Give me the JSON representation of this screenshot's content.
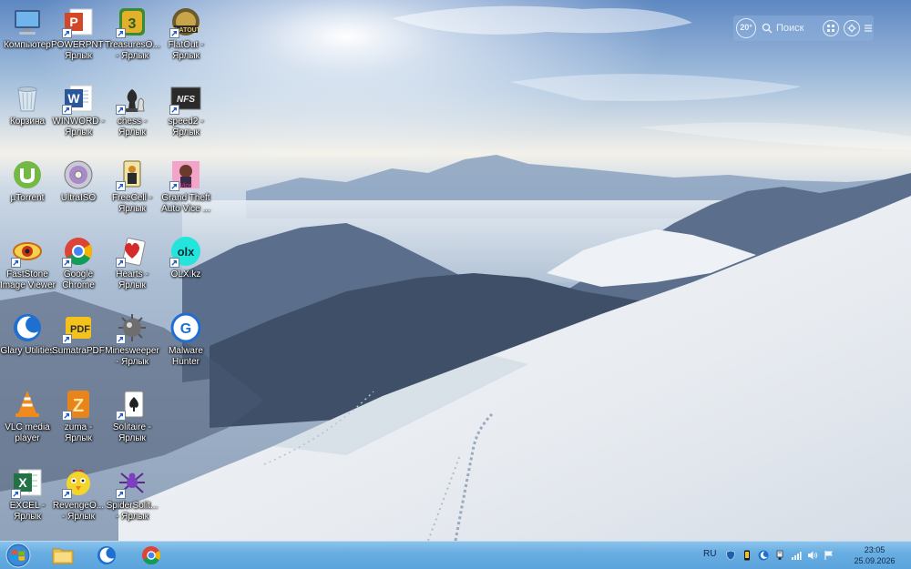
{
  "desktop": {
    "icons": [
      {
        "name": "computer",
        "label1": "Компьютер",
        "label2": ""
      },
      {
        "name": "powerpnt",
        "label1": "POWERPNT -",
        "label2": "Ярлык"
      },
      {
        "name": "treasures",
        "label1": "TreasuresO...",
        "label2": "- Ярлык"
      },
      {
        "name": "flatout",
        "label1": "FlatOut -",
        "label2": "Ярлык"
      },
      {
        "name": "recycle-bin",
        "label1": "Корзина",
        "label2": ""
      },
      {
        "name": "winword",
        "label1": "WINWORD -",
        "label2": "Ярлык"
      },
      {
        "name": "chess",
        "label1": "chess -",
        "label2": "Ярлык"
      },
      {
        "name": "speed2",
        "label1": "speed2 -",
        "label2": "Ярлык"
      },
      {
        "name": "utorrent",
        "label1": "µTorrent",
        "label2": ""
      },
      {
        "name": "ultraiso",
        "label1": "UltraISO",
        "label2": ""
      },
      {
        "name": "freecell",
        "label1": "FreeCell -",
        "label2": "Ярлык"
      },
      {
        "name": "gta",
        "label1": "Grand Theft",
        "label2": "Auto Vice ..."
      },
      {
        "name": "faststone",
        "label1": "FastStone",
        "label2": "Image Viewer"
      },
      {
        "name": "chrome",
        "label1": "Google",
        "label2": "Chrome"
      },
      {
        "name": "hearts",
        "label1": "Hearts -",
        "label2": "Ярлык"
      },
      {
        "name": "olx",
        "label1": "OLX.kz",
        "label2": ""
      },
      {
        "name": "glary",
        "label1": "Glary Utilities",
        "label2": ""
      },
      {
        "name": "sumatra",
        "label1": "SumatraPDF",
        "label2": ""
      },
      {
        "name": "minesweeper",
        "label1": "Minesweeper",
        "label2": "- Ярлык"
      },
      {
        "name": "malware",
        "label1": "Malware",
        "label2": "Hunter"
      },
      {
        "name": "vlc",
        "label1": "VLC media",
        "label2": "player"
      },
      {
        "name": "zuma",
        "label1": "zuma -",
        "label2": "Ярлык"
      },
      {
        "name": "solitaire",
        "label1": "Solitaire -",
        "label2": "Ярлык"
      },
      {
        "name": "excel",
        "label1": "EXCEL -",
        "label2": "Ярлык"
      },
      {
        "name": "revenge",
        "label1": "RevengeO...",
        "label2": "- Ярлык"
      },
      {
        "name": "spider",
        "label1": "SpiderSolit...",
        "label2": "- Ярлык"
      }
    ]
  },
  "search_widget": {
    "weather": "20°",
    "placeholder": "Поиск"
  },
  "taskbar": {
    "language": "RU",
    "time": "23:05",
    "date": "25.09.2026"
  },
  "colors": {
    "taskbar": "#5aa3dc",
    "label_text": "#ffffff"
  }
}
